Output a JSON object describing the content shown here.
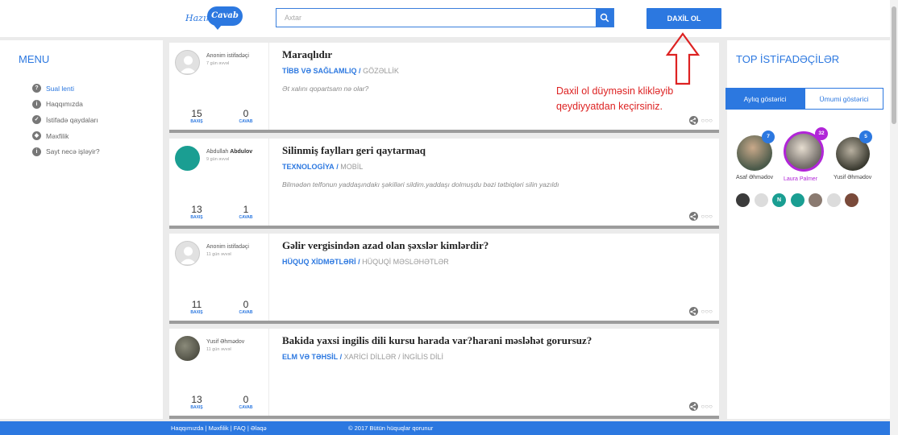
{
  "header": {
    "logo_text_1": "Hazır",
    "logo_text_2": "Cavab",
    "search_placeholder": "Axtar",
    "login_label": "DAXİL OL"
  },
  "menu": {
    "title": "MENU",
    "items": [
      {
        "label": "Sual lenti",
        "icon": "question-icon",
        "active": true
      },
      {
        "label": "Haqqımızda",
        "icon": "info-icon",
        "active": false
      },
      {
        "label": "İstifadə qaydaları",
        "icon": "check-icon",
        "active": false
      },
      {
        "label": "Məxfilik",
        "icon": "shield-icon",
        "active": false
      },
      {
        "label": "Sayt necə işləyir?",
        "icon": "info-icon",
        "active": false
      }
    ]
  },
  "questions": [
    {
      "user": "Anonim istifadəçi",
      "user_bold": "",
      "date": "7 gün əvvəl",
      "avatar": "default",
      "views": "15",
      "views_label": "BAXIŞ",
      "answers": "0",
      "answers_label": "CAVAB",
      "title": "Maraqlıdır",
      "cat_main": "TİBB VƏ SAĞLAMLIQ",
      "cat_sep": "/",
      "cat_sub": "GÖZƏLLİK",
      "body": "Ət xalını qopartsam nə olar?"
    },
    {
      "user": "Abdullah",
      "user_bold": "Abdulov",
      "date": "9 gün əvvəl",
      "avatar": "teal",
      "views": "13",
      "views_label": "BAXIŞ",
      "answers": "1",
      "answers_label": "CAVAB",
      "title": "Silinmiş faylları geri qaytarmaq",
      "cat_main": "TEXNOLOGİYA",
      "cat_sep": "/",
      "cat_sub": "MOBİL",
      "body": "Bilmədən telfonun yaddaşındakı şəkilləri sildim.yaddaşı dolmuşdu bəzi tətbiqləri silin yazıldı"
    },
    {
      "user": "Anonim istifadəçi",
      "user_bold": "",
      "date": "11 gün əvvəl",
      "avatar": "default",
      "views": "11",
      "views_label": "BAXIŞ",
      "answers": "0",
      "answers_label": "CAVAB",
      "title": "Gəlir vergisindən azad olan şəxslər kimlərdir?",
      "cat_main": "HÜQUQ XİDMƏTLƏRİ",
      "cat_sep": "/",
      "cat_sub": "HÜQUQİ MƏSLƏHƏTLƏR",
      "body": ""
    },
    {
      "user": "Yusif Əhmədov",
      "user_bold": "",
      "date": "11 gün əvvəl",
      "avatar": "photo",
      "views": "13",
      "views_label": "BAXIŞ",
      "answers": "0",
      "answers_label": "CAVAB",
      "title": "Bakida yaxsi ingilis dili kursu harada var?harani məsləhət gorursuz?",
      "cat_main": "ELM VƏ TƏHSİL",
      "cat_sep": "/",
      "cat_sub": "XARİCİ DİLLƏR",
      "cat_sep2": "/",
      "cat_sub2": "İNGİLİS DİLİ",
      "body": ""
    }
  ],
  "annotation": {
    "line1": "Daxil ol düyməsin klikləyib",
    "line2": "qeydiyyatdan keçirsiniz.",
    "color": "#dd2222"
  },
  "top_users": {
    "title": "TOP İSTİFADƏÇİLƏR",
    "tab_monthly": "Aylıq göstərici",
    "tab_total": "Ümumi göstərici",
    "users": [
      {
        "name": "Asaf Əhmədov",
        "badge": "7"
      },
      {
        "name": "Laura Palmer",
        "badge": "32"
      },
      {
        "name": "Yusif Əhmədov",
        "badge": "5"
      }
    ],
    "mini_letter": "N"
  },
  "footer": {
    "link1": "Haqqımızda",
    "link2": "Məxfilik",
    "link3": "FAQ",
    "link4": "Əlaqə",
    "sep": "|",
    "copyright": "© 2017 Bütün hüquqlar qorunur"
  },
  "colors": {
    "accent": "#2c78e0",
    "laura_ring": "#b125d8",
    "annotation": "#dd2222"
  }
}
